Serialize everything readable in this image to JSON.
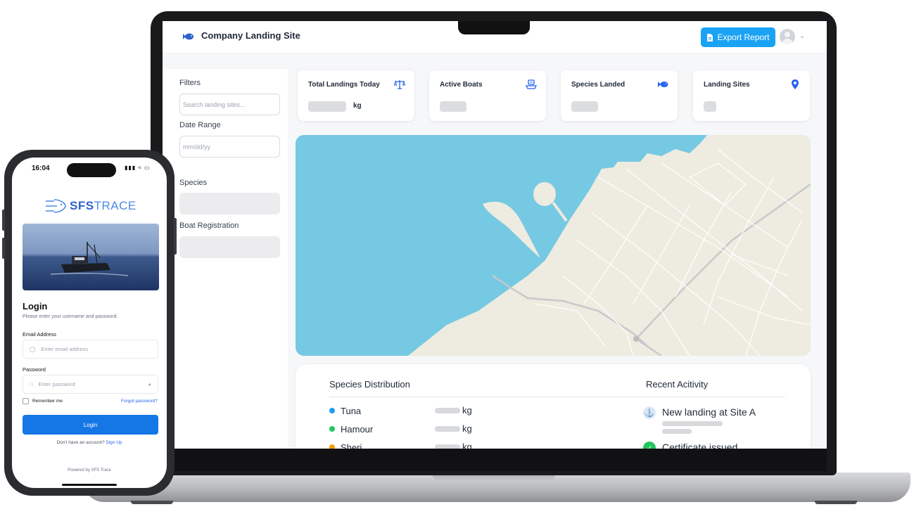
{
  "dashboard": {
    "brand_title": "Company Landing Site",
    "export_label": "Export Report",
    "sidebar": {
      "filters_label": "Filters",
      "search_placeholder": "Search landing sites...",
      "date_label": "Date Range",
      "date_placeholder": "mm/dd/yy",
      "species_label": "Species",
      "boat_label": "Boat Registration"
    },
    "cards": [
      {
        "title": "Total Landings Today",
        "unit": "kg",
        "icon": "scale-icon"
      },
      {
        "title": "Active Boats",
        "unit": "",
        "icon": "boat-icon"
      },
      {
        "title": "Species Landed",
        "unit": "",
        "icon": "fish-icon"
      },
      {
        "title": "Landing Sites",
        "unit": "",
        "icon": "location-pin-icon"
      }
    ],
    "species_panel": {
      "title": "Species Distribution",
      "items": [
        {
          "name": "Tuna",
          "unit": "kg",
          "color": "#1e9bf0"
        },
        {
          "name": "Hamour",
          "unit": "kg",
          "color": "#22c55e"
        },
        {
          "name": "Sheri",
          "unit": "kg",
          "color": "#f59e0b"
        }
      ]
    },
    "activity_panel": {
      "title": "Recent Acitivity",
      "items": [
        {
          "text": "New landing at Site A",
          "icon": "anchor-icon"
        },
        {
          "text": "Certificate issued",
          "icon": "check-icon"
        }
      ]
    },
    "colors": {
      "accent": "#1aa3f4",
      "map_water": "#76c9e3",
      "map_land": "#eeebe0"
    }
  },
  "phone": {
    "time": "16:04",
    "logo_bold": "SFS",
    "logo_light": "TRACE",
    "login_title": "Login",
    "login_subtitle": "Please enter your username and password.",
    "email_label": "Email Address",
    "email_placeholder": "Enter email address",
    "password_label": "Password",
    "password_placeholder": "Enter password",
    "remember_label": "Remember me",
    "forgot_label": "Forgot password?",
    "login_button": "Login",
    "signup_prompt": "Don't have an account?",
    "signup_link": "Sign Up",
    "powered_by": "Powered by SFS Trace"
  }
}
